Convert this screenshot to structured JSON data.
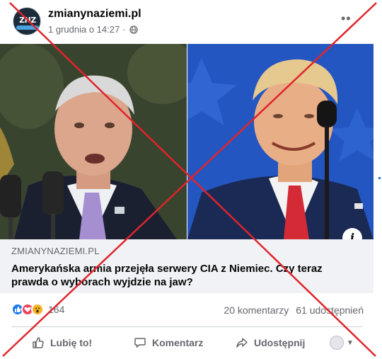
{
  "post": {
    "page_name": "zmianynaziemi.pl",
    "timestamp": "1 grudnia o 14:27",
    "separator": "·",
    "avatar_logo_text": "ZNZ",
    "more_icon": "ellipsis-icon",
    "info_icon_label": "i"
  },
  "link": {
    "domain": "ZMIANYNAZIEMI.PL",
    "title": "Amerykańska armia przejęła serwery CIA z Niemiec. Czy teraz prawda o wyborach wyjdzie na jaw?"
  },
  "engagement": {
    "reaction_count": "164",
    "comments": "20 komentarzy",
    "shares": "61 udostępnień"
  },
  "actions": {
    "like": "Lubię to!",
    "comment": "Komentarz",
    "share": "Udostępnij"
  },
  "colors": {
    "cross": "#e0242b",
    "like_blue": "#1877f2",
    "love_red": "#f33e58",
    "wow_yellow": "#f7b125",
    "muted_text": "#65676b",
    "link_bg": "#f0f2f5"
  }
}
